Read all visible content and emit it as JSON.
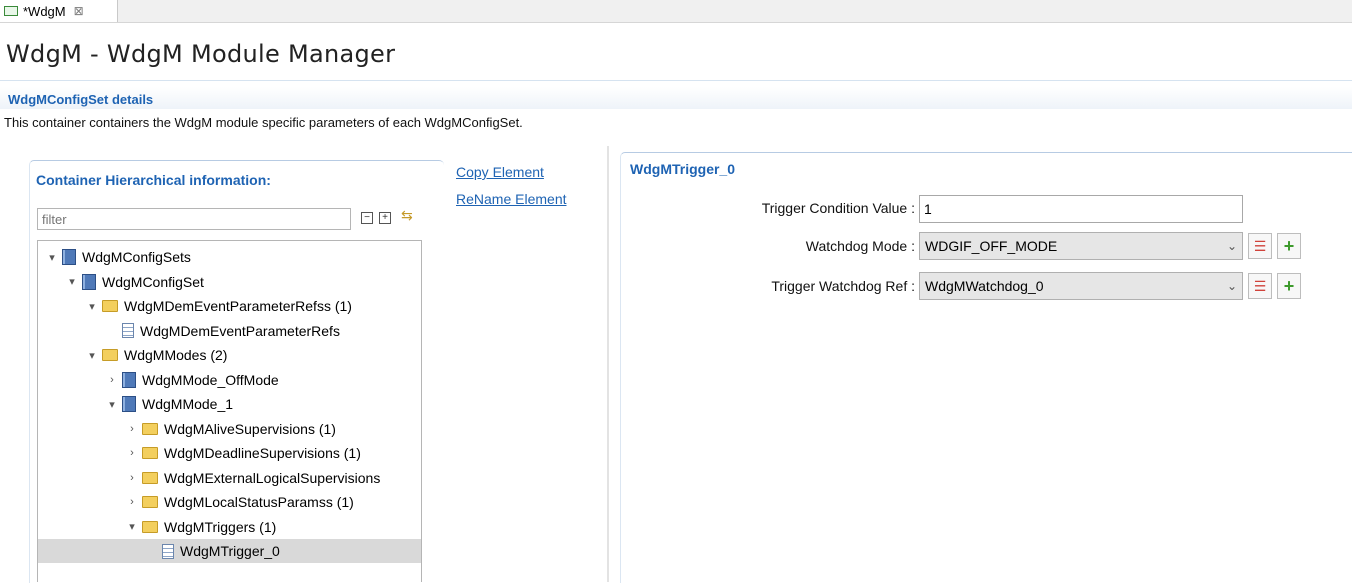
{
  "tab": {
    "label": "*WdgM",
    "close": "⊠"
  },
  "page": {
    "title": "WdgM - WdgM Module Manager",
    "section_heading": "WdgMConfigSet details",
    "section_description": "This container containers the WdgM module specific parameters of each WdgMConfigSet."
  },
  "left": {
    "heading": "Container Hierarchical information:",
    "filter_placeholder": "filter",
    "tree": [
      {
        "label": "WdgMConfigSets",
        "twisty": "expanded",
        "icon": "container-icon"
      },
      {
        "label": "WdgMConfigSet",
        "twisty": "expanded",
        "icon": "container-icon"
      },
      {
        "label": "WdgMDemEventParameterRefss (1)",
        "twisty": "expanded",
        "icon": "folder-icon"
      },
      {
        "label": "WdgMDemEventParameterRefs",
        "twisty": "none",
        "icon": "item-icon"
      },
      {
        "label": "WdgMModes (2)",
        "twisty": "expanded",
        "icon": "folder-icon"
      },
      {
        "label": "WdgMMode_OffMode",
        "twisty": "collapsed",
        "icon": "container-icon"
      },
      {
        "label": "WdgMMode_1",
        "twisty": "expanded",
        "icon": "container-icon"
      },
      {
        "label": "WdgMAliveSupervisions (1)",
        "twisty": "collapsed",
        "icon": "folder-icon"
      },
      {
        "label": "WdgMDeadlineSupervisions (1)",
        "twisty": "collapsed",
        "icon": "folder-icon"
      },
      {
        "label": "WdgMExternalLogicalSupervisions",
        "twisty": "collapsed",
        "icon": "folder-icon"
      },
      {
        "label": "WdgMLocalStatusParamss (1)",
        "twisty": "collapsed",
        "icon": "folder-icon"
      },
      {
        "label": "WdgMTriggers (1)",
        "twisty": "expanded",
        "icon": "folder-icon"
      },
      {
        "label": "WdgMTrigger_0",
        "twisty": "none",
        "icon": "item-icon",
        "selected": true
      }
    ]
  },
  "actions": {
    "copy": "Copy Element",
    "rename": "ReName Element"
  },
  "right": {
    "heading": "WdgMTrigger_0",
    "trigger_condition_label": "Trigger Condition Value :",
    "trigger_condition_value": "1",
    "watchdog_mode_label": "Watchdog Mode :",
    "watchdog_mode_value": "WDGIF_OFF_MODE",
    "trigger_watchdog_ref_label": "Trigger Watchdog Ref :",
    "trigger_watchdog_ref_value": "WdgMWatchdog_0"
  },
  "icons": {
    "collapse_all": "collapse-all-icon",
    "expand_all": "expand-all-icon",
    "sync": "sync-icon",
    "list": "list-icon",
    "add": "plus-icon"
  }
}
